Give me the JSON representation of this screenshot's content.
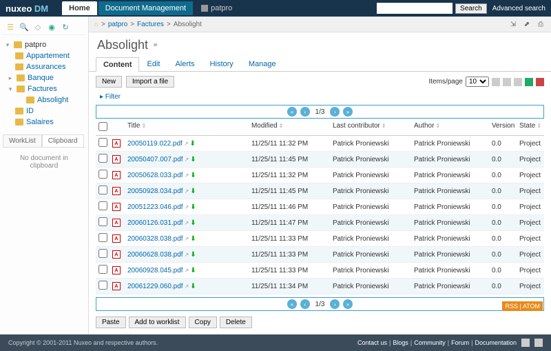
{
  "brand": {
    "name": "nuxeo",
    "sub": "DM"
  },
  "topnav": {
    "home": "Home",
    "dm": "Document Management"
  },
  "user": "patpro",
  "search": {
    "placeholder": "",
    "button": "Search",
    "advanced": "Advanced search"
  },
  "sidebar": {
    "root": "patpro",
    "items": [
      "Appartement",
      "Assurances",
      "Banque",
      "Factures",
      "ID",
      "Salaires"
    ],
    "factures_children": [
      "Absolight"
    ],
    "wl_tab": "WorkList",
    "cb_tab": "Clipboard",
    "cb_empty": "No document in clipboard"
  },
  "breadcrumb": {
    "root": "patpro",
    "mid": "Factures",
    "leaf": "Absolight"
  },
  "title": "Absolight",
  "tabs": {
    "content": "Content",
    "edit": "Edit",
    "alerts": "Alerts",
    "history": "History",
    "manage": "Manage"
  },
  "toolbar": {
    "new": "New",
    "import": "Import a file",
    "items_label": "Items/page",
    "items_value": "10"
  },
  "filter_label": "Filter",
  "pager": {
    "page": "1",
    "total": "3"
  },
  "columns": {
    "title": "Title",
    "modified": "Modified",
    "contrib": "Last contributor",
    "author": "Author",
    "version": "Version",
    "state": "State"
  },
  "rows": [
    {
      "title": "20050119.022.pdf",
      "modified": "11/25/11 11:32 PM",
      "contrib": "Patrick Proniewski",
      "author": "Patrick Proniewski",
      "version": "0.0",
      "state": "Project"
    },
    {
      "title": "20050407.007.pdf",
      "modified": "11/25/11 11:45 PM",
      "contrib": "Patrick Proniewski",
      "author": "Patrick Proniewski",
      "version": "0.0",
      "state": "Project"
    },
    {
      "title": "20050628.033.pdf",
      "modified": "11/25/11 11:32 PM",
      "contrib": "Patrick Proniewski",
      "author": "Patrick Proniewski",
      "version": "0.0",
      "state": "Project"
    },
    {
      "title": "20050928.034.pdf",
      "modified": "11/25/11 11:45 PM",
      "contrib": "Patrick Proniewski",
      "author": "Patrick Proniewski",
      "version": "0.0",
      "state": "Project"
    },
    {
      "title": "20051223.046.pdf",
      "modified": "11/25/11 11:46 PM",
      "contrib": "Patrick Proniewski",
      "author": "Patrick Proniewski",
      "version": "0.0",
      "state": "Project"
    },
    {
      "title": "20060126.031.pdf",
      "modified": "11/25/11 11:47 PM",
      "contrib": "Patrick Proniewski",
      "author": "Patrick Proniewski",
      "version": "0.0",
      "state": "Project"
    },
    {
      "title": "20060328.038.pdf",
      "modified": "11/25/11 11:33 PM",
      "contrib": "Patrick Proniewski",
      "author": "Patrick Proniewski",
      "version": "0.0",
      "state": "Project"
    },
    {
      "title": "20060628.038.pdf",
      "modified": "11/25/11 11:33 PM",
      "contrib": "Patrick Proniewski",
      "author": "Patrick Proniewski",
      "version": "0.0",
      "state": "Project"
    },
    {
      "title": "20060928.045.pdf",
      "modified": "11/25/11 11:33 PM",
      "contrib": "Patrick Proniewski",
      "author": "Patrick Proniewski",
      "version": "0.0",
      "state": "Project"
    },
    {
      "title": "20061229.060.pdf",
      "modified": "11/25/11 11:34 PM",
      "contrib": "Patrick Proniewski",
      "author": "Patrick Proniewski",
      "version": "0.0",
      "state": "Project"
    }
  ],
  "actions": {
    "paste": "Paste",
    "addwl": "Add to worklist",
    "copy": "Copy",
    "del": "Delete"
  },
  "rss": "RSS | ATOM",
  "footer": {
    "copyright": "Copyright © 2001-2011 Nuxeo and respective authors.",
    "links": [
      "Contact us",
      "Blogs",
      "Community",
      "Forum",
      "Documentation"
    ]
  }
}
